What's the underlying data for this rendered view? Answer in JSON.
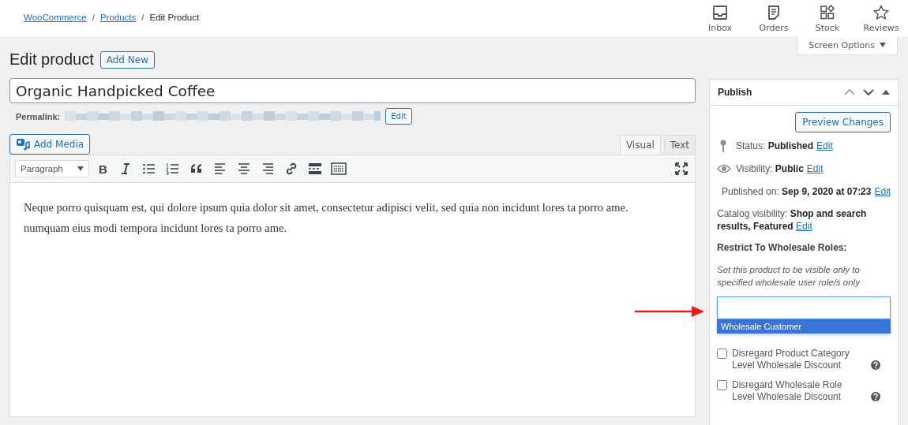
{
  "breadcrumbs": [
    {
      "kind": "link",
      "label": "WooCommerce"
    },
    {
      "kind": "separator",
      "label": "/"
    },
    {
      "kind": "link",
      "label": "Products"
    },
    {
      "kind": "separator",
      "label": "/"
    },
    {
      "kind": "current",
      "label": "Edit Product"
    }
  ],
  "header_actions": [
    {
      "label": "Inbox",
      "kind": "inbox"
    },
    {
      "label": "Orders",
      "kind": "document"
    },
    {
      "label": "Stock",
      "kind": "blocks"
    },
    {
      "label": "Reviews",
      "kind": "star"
    }
  ],
  "screen_options": {
    "label": "Screen Options"
  },
  "page_title": "Edit product",
  "add_new": "Add New",
  "title_field": {
    "value": "Organic Handpicked Coffee"
  },
  "permalink": {
    "label": "Permalink:",
    "edit": "Edit"
  },
  "add_media": "Add Media",
  "editor_tabs": [
    {
      "label": "Visual",
      "selected": true
    },
    {
      "label": "Text",
      "selected": false
    }
  ],
  "format_select": {
    "value": "Paragraph"
  },
  "toolbar": [
    {
      "kind": "bold",
      "glyph": "B"
    },
    {
      "kind": "italic"
    },
    {
      "kind": "bullets"
    },
    {
      "kind": "numbers"
    },
    {
      "kind": "quote"
    },
    {
      "kind": "align-left"
    },
    {
      "kind": "align-center"
    },
    {
      "kind": "align-right"
    },
    {
      "kind": "link"
    },
    {
      "kind": "more"
    },
    {
      "kind": "toolbar-toggle"
    }
  ],
  "content": [
    "Neque porro quisquam est, qui dolore ipsum quia dolor sit amet, consectetur adipisci velit, sed quia non incidunt lores ta porro ame.",
    "numquam eius modi tempora incidunt lores ta porro ame."
  ],
  "publish": {
    "title": "Publish",
    "preview": "Preview Changes",
    "rows": [
      {
        "kind": "status",
        "label": "Status:",
        "value": "Published",
        "link": "Edit"
      },
      {
        "kind": "visibility",
        "label": "Visibility:",
        "value": "Public",
        "link": "Edit"
      },
      {
        "kind": "date",
        "label": "Published on:",
        "value": "Sep 9, 2020 at 07:23",
        "link": "Edit"
      }
    ],
    "catalog": {
      "label": "Catalog visibility:",
      "value": "Shop and search results, Featured",
      "link": "Edit"
    },
    "restrict_heading": "Restrict To Wholesale Roles:",
    "restrict_hint": "Set this product to be visible only to specified wholesale user role/s only",
    "role_options": [
      {
        "label": "Wholesale Customer",
        "selected": true
      }
    ],
    "checkboxes": [
      {
        "label": "Disregard Product Category Level Wholesale Discount",
        "checked": false
      },
      {
        "label": "Disregard Wholesale Role Level Wholesale Discount",
        "checked": false
      }
    ]
  }
}
